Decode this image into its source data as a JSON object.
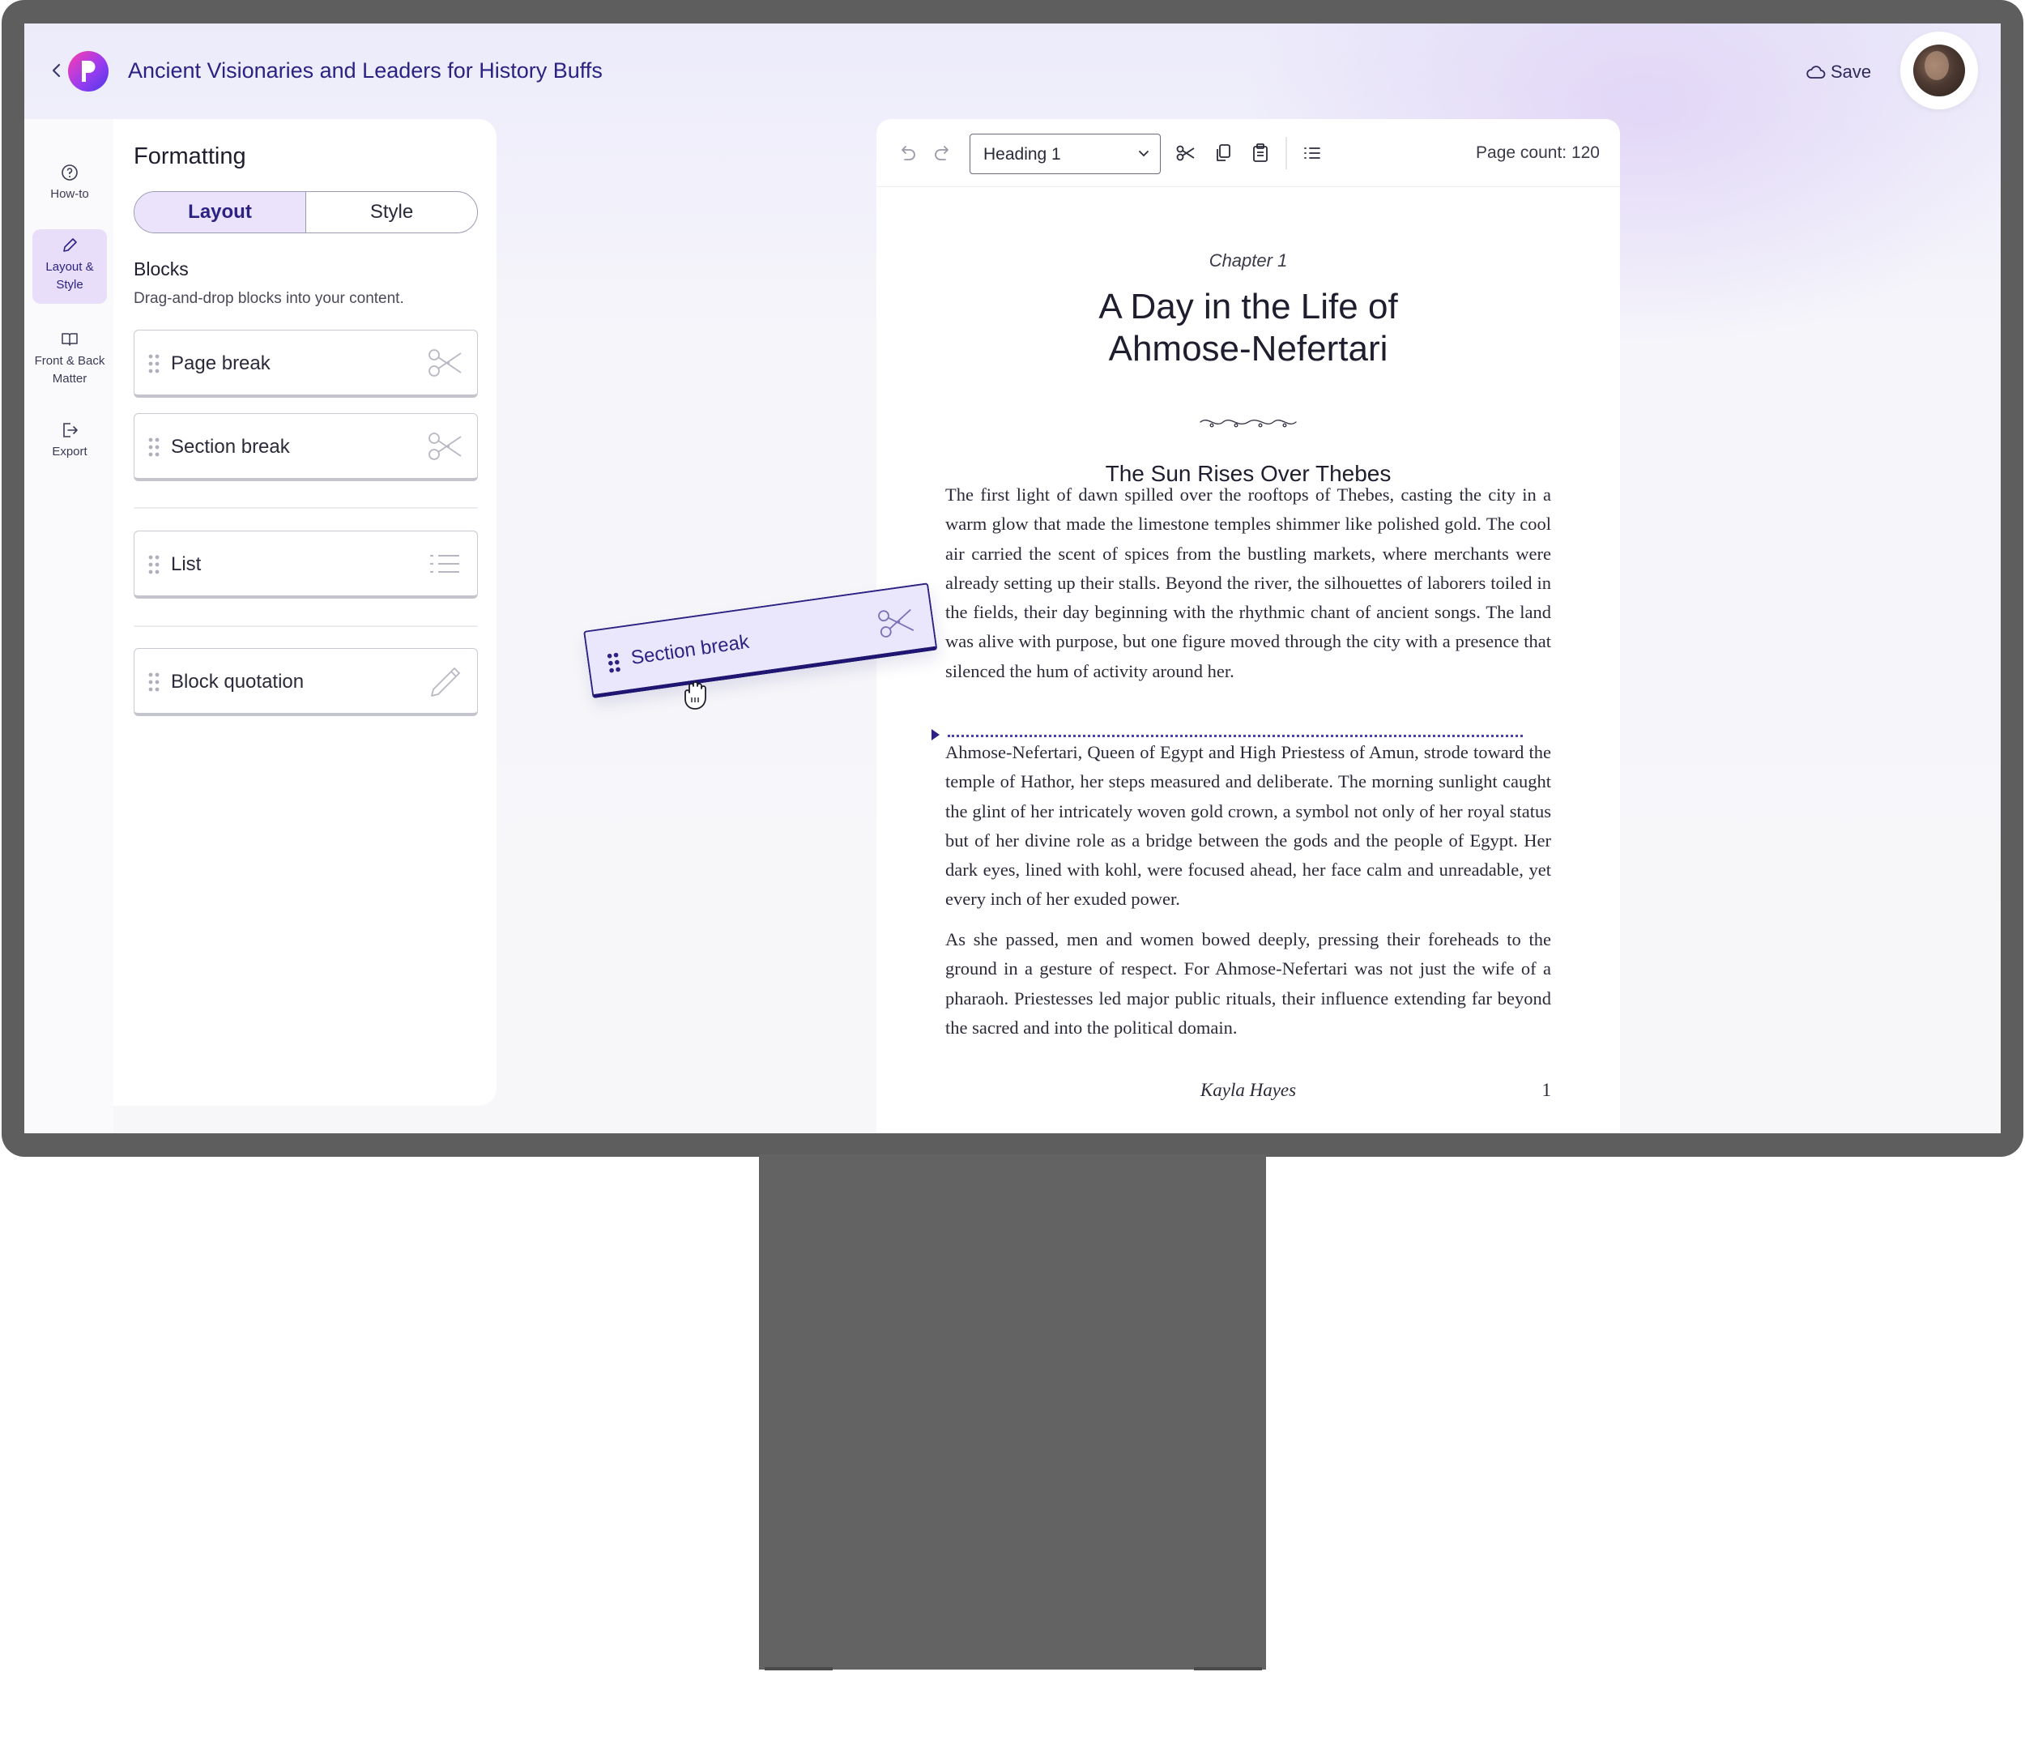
{
  "header": {
    "title": "Ancient Visionaries and Leaders for History Buffs",
    "save_label": "Save"
  },
  "rail": {
    "items": [
      {
        "label": "How-to",
        "icon": "help-circle-icon"
      },
      {
        "label": "Layout & Style",
        "icon": "pencil-icon",
        "active": true
      },
      {
        "label": "Front & Back Matter",
        "icon": "book-icon"
      },
      {
        "label": "Export",
        "icon": "export-icon"
      }
    ]
  },
  "panel": {
    "title": "Formatting",
    "tabs": [
      {
        "label": "Layout",
        "active": true
      },
      {
        "label": "Style",
        "active": false
      }
    ],
    "blocks_heading": "Blocks",
    "blocks_sub": "Drag-and-drop blocks into your content.",
    "blocks": [
      {
        "label": "Page break",
        "icon": "scissors-icon"
      },
      {
        "label": "Section break",
        "icon": "scissors-icon"
      },
      {
        "label": "List",
        "icon": "list-icon"
      },
      {
        "label": "Block quotation",
        "icon": "pencil-icon"
      }
    ]
  },
  "drag": {
    "label": "Section break",
    "icon": "scissors-icon"
  },
  "toolbar": {
    "style_select": "Heading 1",
    "page_count": "Page count: 120"
  },
  "doc": {
    "chapter": "Chapter 1",
    "title_line1": "A Day in the Life of",
    "title_line2": "Ahmose-Nefertari",
    "section_title": "The Sun Rises Over Thebes",
    "paragraphs": [
      "The first light of dawn spilled over the rooftops of Thebes, casting the city in a warm glow that made the limestone temples shimmer like polished gold. The cool air carried the scent of spices from the bustling markets, where merchants were already setting up their stalls. Beyond the river, the silhouettes of laborers toiled in the fields, their day beginning with the rhythmic chant of ancient songs. The land was alive with purpose, but one figure moved through the city with a presence that silenced the hum of activity around her.",
      "Ahmose-Nefertari, Queen of Egypt and High Priestess of Amun, strode toward the temple of Hathor, her steps measured and deliberate. The morning sunlight caught the glint of her intricately woven gold crown, a symbol not only of her royal status but of her divine role as a bridge between the gods and the people of Egypt. Her dark eyes, lined with kohl, were focused ahead, her face calm and unreadable, yet every inch of her exuded power.",
      "As she passed, men and women bowed deeply, pressing their foreheads to the ground in a gesture of respect. For Ahmose-Nefertari was not just the wife of a pharaoh. Priestesses led major public rituals, their influence extending far beyond the sacred and into the political domain."
    ],
    "footer_author": "Kayla Hayes",
    "footer_page": "1"
  },
  "colors": {
    "brand": "#2b2283",
    "accent_bg": "#ebe3fb",
    "bezel": "#5e5e5e"
  }
}
